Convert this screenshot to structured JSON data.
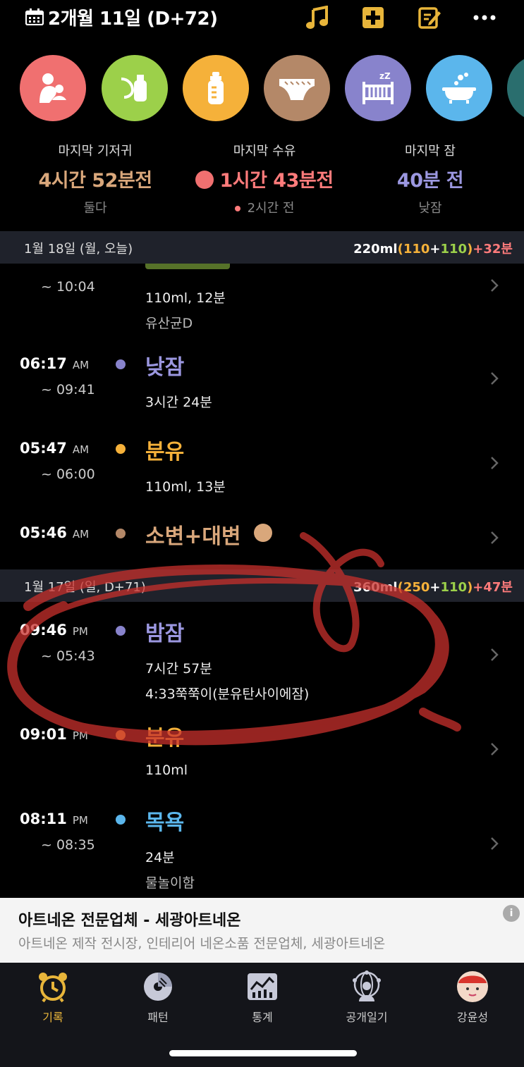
{
  "header": {
    "title": "2개월 11일 (D+72)",
    "icons": [
      "calendar-icon",
      "music-note-icon",
      "plus-box-icon",
      "edit-note-icon",
      "more-icon"
    ],
    "accent": "#e8b53a"
  },
  "categories": [
    {
      "name": "nursing",
      "icon": "mother-baby-icon",
      "color": "#f07070"
    },
    {
      "name": "pumping",
      "icon": "breast-pump-icon",
      "color": "#9cd04a"
    },
    {
      "name": "formula",
      "icon": "bottle-icon",
      "color": "#f5b13a"
    },
    {
      "name": "diaper",
      "icon": "diaper-icon",
      "color": "#b48868"
    },
    {
      "name": "sleep",
      "icon": "crib-icon",
      "color": "#8883cc"
    },
    {
      "name": "bath",
      "icon": "bathtub-icon",
      "color": "#5bb6ec"
    },
    {
      "name": "more",
      "icon": "more-category-icon",
      "color": "#2a6e6e"
    }
  ],
  "summary": {
    "diaper": {
      "label": "마지막 기저귀",
      "value": "4시간 52분전",
      "sub": "둘다",
      "color": "#d9a77b"
    },
    "feeding": {
      "label": "마지막 수유",
      "value": "1시간 43분전",
      "sub": "2시간 전",
      "color": "#ff7b7b"
    },
    "sleep": {
      "label": "마지막 잠",
      "value": "40분 전",
      "sub": "낮잠",
      "color": "#9b97e0"
    }
  },
  "day1": {
    "date": "1월 18일 (월, 오늘)",
    "total": "220ml",
    "open": "(",
    "a": "110",
    "plus": "+",
    "b": "110",
    "close": ")",
    "extra": "+32분"
  },
  "day2": {
    "date": "1월 17일 (일, D+71)",
    "total": "360ml",
    "open": "(",
    "a": "250",
    "plus": "+",
    "b": "110",
    "close": ")",
    "extra": "+47분"
  },
  "entries1": [
    {
      "time": "",
      "ampm": "",
      "end": "~ 10:04",
      "title": "",
      "detail1": "110ml, 12분",
      "detail2": "유산균D"
    },
    {
      "time": "06:17",
      "ampm": "AM",
      "end": "~ 09:41",
      "title": "낮잠",
      "detail1": "3시간 24분",
      "detail2": ""
    },
    {
      "time": "05:47",
      "ampm": "AM",
      "end": "~ 06:00",
      "title": "분유",
      "detail1": "110ml, 13분",
      "detail2": ""
    },
    {
      "time": "05:46",
      "ampm": "AM",
      "end": "",
      "title": "소변+대변",
      "detail1": "",
      "detail2": ""
    }
  ],
  "entries2": [
    {
      "time": "09:46",
      "ampm": "PM",
      "end": "~ 05:43",
      "title": "밤잠",
      "detail1": "7시간 57분",
      "detail2": "4:33쭉쭉이(분유탄사이에잠)"
    },
    {
      "time": "09:01",
      "ampm": "PM",
      "end": "",
      "title": "분유",
      "detail1": "110ml",
      "detail2": ""
    },
    {
      "time": "08:11",
      "ampm": "PM",
      "end": "~ 08:35",
      "title": "목욕",
      "detail1": "24분",
      "detail2": "물놀이함"
    }
  ],
  "colors": {
    "sleep": "#9b97e0",
    "formula": "#f5b13a",
    "diaper": "#d9a77b",
    "bath": "#5bb6ec",
    "ml": "#ffffff",
    "a": "#f5b13a",
    "b": "#9cd04a",
    "extra": "#ff7b7b"
  },
  "ad": {
    "headline": "아트네온 전문업체 - 세광아트네온",
    "subline": "아트네온 제작 전시장, 인테리어 네온소품 전문업체, 세광아트네온",
    "info": "i"
  },
  "tabs": [
    {
      "label": "기록",
      "icon": "alarm-clock-icon",
      "active": true
    },
    {
      "label": "패턴",
      "icon": "pattern-chart-icon",
      "active": false
    },
    {
      "label": "통계",
      "icon": "stats-chart-icon",
      "active": false
    },
    {
      "label": "공개일기",
      "icon": "public-diary-icon",
      "active": false
    },
    {
      "label": "강윤성",
      "icon": "profile-avatar",
      "active": false
    }
  ]
}
